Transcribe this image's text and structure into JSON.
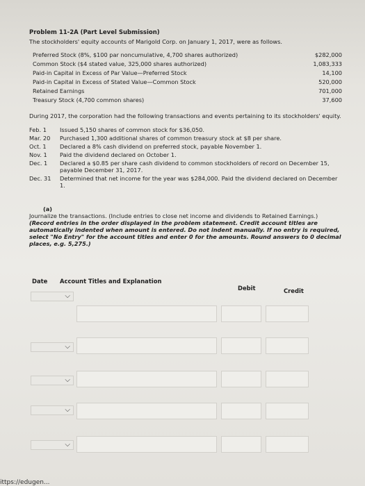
{
  "problem": {
    "title": "Problem 11-2A (Part Level Submission)",
    "intro": "The stockholders' equity accounts of Marigold Corp. on January 1, 2017, were as follows."
  },
  "balances": [
    {
      "label": "Preferred Stock (8%, $100 par noncumulative, 4,700 shares authorized)",
      "amount": "$282,000"
    },
    {
      "label": "Common Stock ($4 stated value, 325,000 shares authorized)",
      "amount": "1,083,333"
    },
    {
      "label": "Paid-in Capital in Excess of Par Value—Preferred Stock",
      "amount": "14,100"
    },
    {
      "label": "Paid-in Capital in Excess of Stated Value—Common Stock",
      "amount": "520,000"
    },
    {
      "label": "Retained Earnings",
      "amount": "701,000"
    },
    {
      "label": "Treasury Stock (4,700 common shares)",
      "amount": "37,600"
    }
  ],
  "during": "During 2017, the corporation had the following transactions and events pertaining to its stockholders' equity.",
  "transactions": [
    {
      "date": "Feb.  1",
      "text": "Issued 5,150 shares of common stock for $36,050."
    },
    {
      "date": "Mar. 20",
      "text": "Purchased 1,300 additional shares of common treasury stock at $8 per share."
    },
    {
      "date": "Oct.  1",
      "text": "Declared a 8% cash dividend on preferred stock, payable November 1."
    },
    {
      "date": "Nov.  1",
      "text": "Paid the dividend declared on October 1."
    },
    {
      "date": "Dec.  1",
      "text": "Declared a $0.85 per share cash dividend to common stockholders of record on December 15, payable December 31, 2017."
    },
    {
      "date": "Dec. 31",
      "text": "Determined that net income for the year was $284,000. Paid the dividend declared on December 1."
    }
  ],
  "part_a": {
    "label": "(a)",
    "instruction": "Journalize the transactions. (Include entries to close net income and dividends to Retained Earnings.)",
    "emphasis": "(Record entries in the order displayed in the problem statement. Credit account titles are automatically indented when amount is entered. Do not indent manually. If no entry is required, select \"No Entry\" for the account titles and enter 0 for the amounts. Round answers to 0 decimal places, e.g. 5,275.)"
  },
  "table_header": {
    "date": "Date",
    "account": "Account Titles and Explanation",
    "debit": "Debit",
    "credit": "Credit"
  },
  "chevron": "⌵",
  "url_fragment": "ittps://edugen..."
}
